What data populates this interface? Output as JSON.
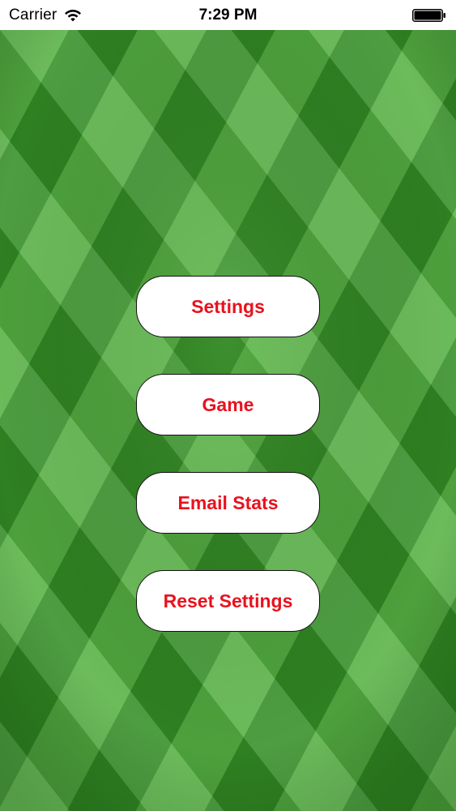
{
  "status_bar": {
    "carrier": "Carrier",
    "time": "7:29 PM",
    "wifi_icon": "wifi-icon",
    "battery_icon": "battery-full-icon"
  },
  "background": {
    "description_icon": "grass-field-background",
    "colors": {
      "light_stripe": "#5bb648",
      "dark_stripe": "#2e8a22",
      "base": "#3f9a2c"
    }
  },
  "menu": {
    "settings_label": "Settings",
    "game_label": "Game",
    "email_stats_label": "Email Stats",
    "reset_settings_label": "Reset Settings",
    "button_text_color": "#e8121e",
    "button_background": "#ffffff"
  }
}
